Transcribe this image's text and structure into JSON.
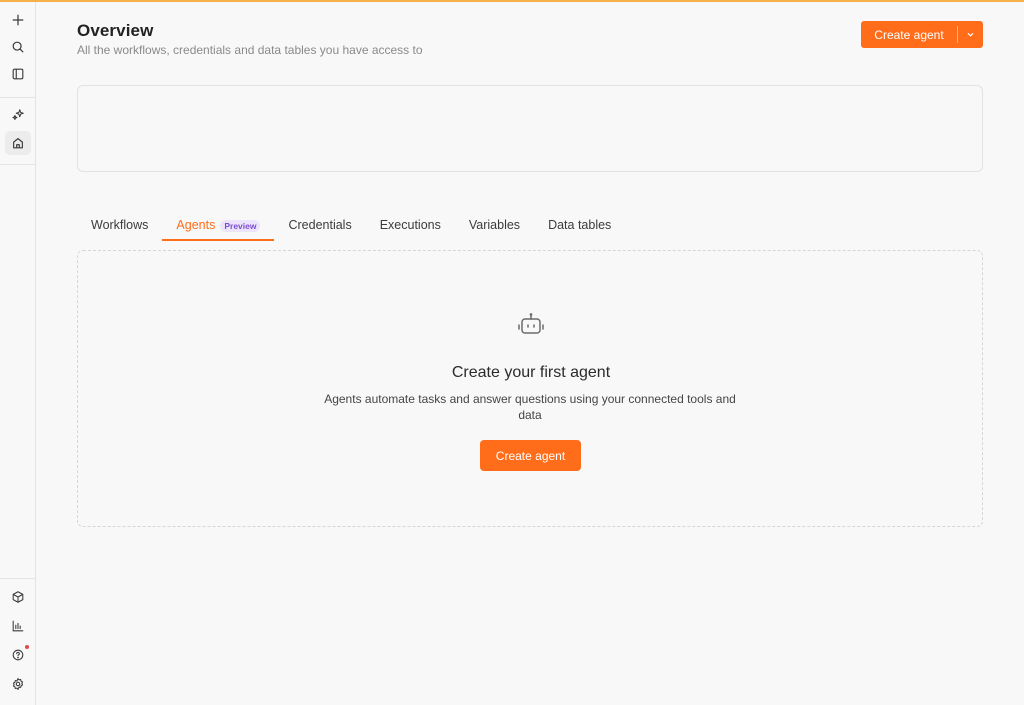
{
  "header": {
    "title": "Overview",
    "subtitle": "All the workflows, credentials and data tables you have access to",
    "create_button_label": "Create agent"
  },
  "tabs": [
    {
      "label": "Workflows"
    },
    {
      "label": "Agents",
      "badge": "Preview",
      "active": true
    },
    {
      "label": "Credentials"
    },
    {
      "label": "Executions"
    },
    {
      "label": "Variables"
    },
    {
      "label": "Data tables"
    }
  ],
  "empty_state": {
    "icon": "robot-icon",
    "title": "Create your first agent",
    "description": "Agents automate tasks and answer questions using your connected tools and data",
    "button_label": "Create agent"
  },
  "sidebar": {
    "top_icons": [
      "plus-icon",
      "search-icon",
      "panel-icon"
    ],
    "nav_icons": [
      "sparkle-icon",
      "home-icon"
    ],
    "bottom_icons": [
      "package-icon",
      "chart-icon",
      "help-icon",
      "settings-icon"
    ]
  },
  "colors": {
    "accent": "#ff6d1a",
    "badge_text": "#7c4dcf",
    "badge_bg": "#ece4fb",
    "notification": "#e5484d"
  }
}
